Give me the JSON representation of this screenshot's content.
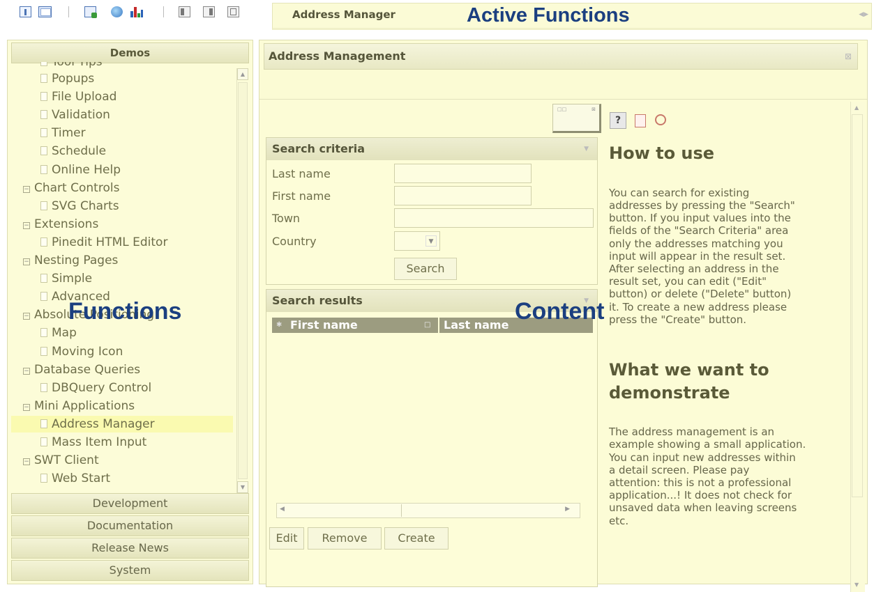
{
  "toolbar": {
    "icons": [
      "info-icon",
      "window-icon",
      "export-icon",
      "globe-icon",
      "bar-chart-icon",
      "layout-left-icon",
      "layout-right-icon",
      "layout-close-icon"
    ]
  },
  "active_functions": {
    "tab": "Address Manager",
    "overlay_label": "Active Functions"
  },
  "left": {
    "demos_label": "Demos",
    "partial_item": "Tool Tips",
    "tree": [
      {
        "label": "Popups",
        "type": "leaf"
      },
      {
        "label": "File Upload",
        "type": "leaf"
      },
      {
        "label": "Validation",
        "type": "leaf"
      },
      {
        "label": "Timer",
        "type": "leaf"
      },
      {
        "label": "Schedule",
        "type": "leaf"
      },
      {
        "label": "Online Help",
        "type": "leaf"
      },
      {
        "label": "Chart Controls",
        "type": "folder"
      },
      {
        "label": "SVG Charts",
        "type": "leaf"
      },
      {
        "label": "Extensions",
        "type": "folder"
      },
      {
        "label": "Pinedit HTML Editor",
        "type": "leaf"
      },
      {
        "label": "Nesting Pages",
        "type": "folder"
      },
      {
        "label": "Simple",
        "type": "leaf"
      },
      {
        "label": "Advanced",
        "type": "leaf"
      },
      {
        "label": "Absolute Positioning",
        "type": "folder"
      },
      {
        "label": "Map",
        "type": "leaf"
      },
      {
        "label": "Moving Icon",
        "type": "leaf"
      },
      {
        "label": "Database Queries",
        "type": "folder"
      },
      {
        "label": "DBQuery Control",
        "type": "leaf"
      },
      {
        "label": "Mini Applications",
        "type": "folder"
      },
      {
        "label": "Address Manager",
        "type": "leaf",
        "selected": true
      },
      {
        "label": "Mass Item Input",
        "type": "leaf"
      },
      {
        "label": "SWT Client",
        "type": "folder"
      },
      {
        "label": "Web Start",
        "type": "leaf"
      }
    ],
    "sections": [
      "Development",
      "Documentation",
      "Release News",
      "System"
    ],
    "overlay_label": "Functions"
  },
  "content": {
    "panel_title": "Address Management",
    "overlay_label": "Content",
    "search_criteria": {
      "title": "Search criteria",
      "last_name_label": "Last name",
      "first_name_label": "First name",
      "town_label": "Town",
      "country_label": "Country",
      "last_name_value": "",
      "first_name_value": "",
      "town_value": "",
      "country_value": "",
      "search_button": "Search"
    },
    "search_results": {
      "title": "Search results",
      "columns": [
        "First name",
        "Last name"
      ]
    },
    "actions": {
      "edit": "Edit",
      "remove": "Remove",
      "create": "Create"
    },
    "help": {
      "heading1": "How to use",
      "para1_lines": [
        "You can search for existing",
        "addresses by pressing the \"Search\"",
        "button. If you input values into the",
        "fields of the \"Search Criteria\" area",
        "only the addresses matching you",
        "input will appear in the result set.",
        "After selecting an address in the",
        "result set, you can edit (\"Edit\"",
        "button) or delete (\"Delete\" button)",
        "it. To create a new address please",
        "press the \"Create\" button."
      ],
      "heading2_lines": [
        "What we want to",
        "demonstrate"
      ],
      "para2_lines": [
        "The address management is an",
        "example showing a small application.",
        "You can input new addresses within",
        "a detail screen. Please pay",
        "attention: this is not a professional",
        "application...! It does not check for",
        "unsaved data when leaving screens",
        "etc."
      ]
    }
  }
}
